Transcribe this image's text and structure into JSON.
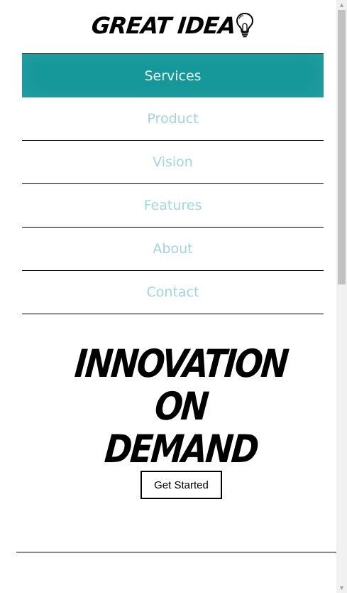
{
  "header": {
    "logo_text": "GREAT IDEA",
    "logo_icon": "lightbulb-icon"
  },
  "nav": {
    "items": [
      {
        "label": "Services",
        "active": true
      },
      {
        "label": "Product",
        "active": false
      },
      {
        "label": "Vision",
        "active": false
      },
      {
        "label": "Features",
        "active": false
      },
      {
        "label": "About",
        "active": false
      },
      {
        "label": "Contact",
        "active": false
      }
    ]
  },
  "hero": {
    "lines": [
      "INNOVATION",
      "ON",
      "DEMAND"
    ],
    "cta_label": "Get Started"
  },
  "colors": {
    "active_nav_bg": "#16979a",
    "nav_text": "#9fd6df",
    "active_nav_text": "#e9f6f6"
  },
  "scrollbar": {
    "up_icon": "chevron-up-icon",
    "down_icon": "chevron-down-icon"
  }
}
